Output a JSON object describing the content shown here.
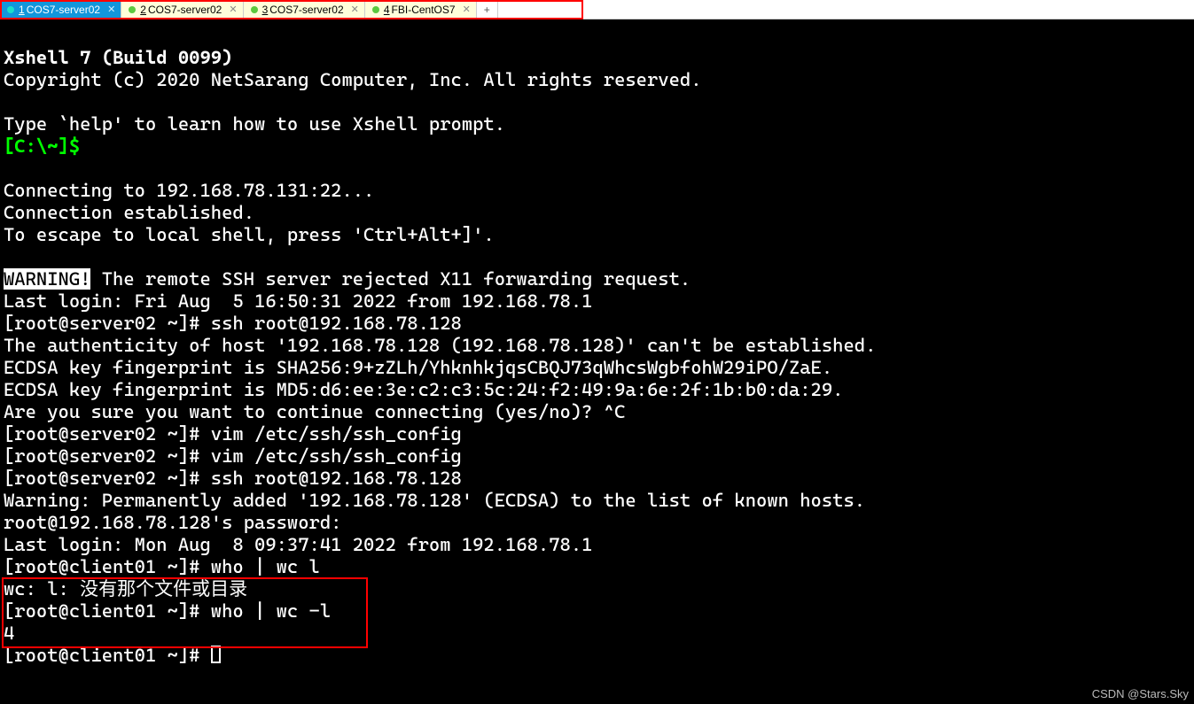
{
  "tabs": [
    {
      "num": "1",
      "label": "COS7-server02",
      "active": true
    },
    {
      "num": "2",
      "label": "COS7-server02",
      "active": false
    },
    {
      "num": "3",
      "label": "COS7-server02",
      "active": false
    },
    {
      "num": "4",
      "label": "FBI-CentOS7",
      "active": false
    }
  ],
  "add_tab_label": "+",
  "terminal": {
    "line_header": "Xshell 7 (Build 0099)",
    "line_copyright": "Copyright (c) 2020 NetSarang Computer, Inc. All rights reserved.",
    "line_help": "Type `help' to learn how to use Xshell prompt.",
    "prompt_local": "[C:\\~]$",
    "line_connecting": "Connecting to 192.168.78.131:22...",
    "line_connected": "Connection established.",
    "line_escape": "To escape to local shell, press 'Ctrl+Alt+]'.",
    "warning_tag": "WARNING!",
    "warning_rest": " The remote SSH server rejected X11 forwarding request.",
    "line_lastlogin1": "Last login: Fri Aug  5 16:50:31 2022 from 192.168.78.1",
    "line_p1": "[root@server02 ~]# ssh root@192.168.78.128",
    "line_auth": "The authenticity of host '192.168.78.128 (192.168.78.128)' can't be established.",
    "line_fp1": "ECDSA key fingerprint is SHA256:9+zZLh/YhknhkjqsCBQJ73qWhcsWgbfohW29iPO/ZaE.",
    "line_fp2": "ECDSA key fingerprint is MD5:d6:ee:3e:c2:c3:5c:24:f2:49:9a:6e:2f:1b:b0:da:29.",
    "line_sure": "Are you sure you want to continue connecting (yes/no)? ^C",
    "line_p2": "[root@server02 ~]# vim /etc/ssh/ssh_config",
    "line_p3": "[root@server02 ~]# vim /etc/ssh/ssh_config",
    "line_p4": "[root@server02 ~]# ssh root@192.168.78.128",
    "line_warnadd": "Warning: Permanently added '192.168.78.128' (ECDSA) to the list of known hosts.",
    "line_pass": "root@192.168.78.128's password: ",
    "line_lastlogin2": "Last login: Mon Aug  8 09:37:41 2022 from 192.168.78.1",
    "line_p5": "[root@client01 ~]# who | wc l",
    "line_wcerr": "wc: l: 没有那个文件或目录",
    "line_p6": "[root@client01 ~]# who | wc -l",
    "line_out": "4",
    "line_p7": "[root@client01 ~]# "
  },
  "watermark": "CSDN @Stars.Sky"
}
